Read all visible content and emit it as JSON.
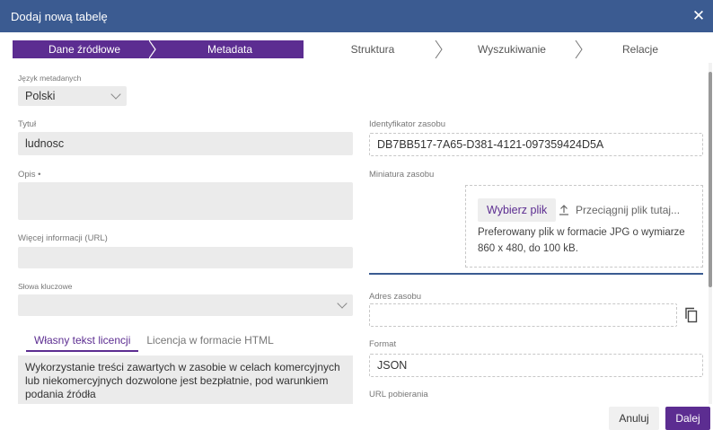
{
  "dialog": {
    "title": "Dodaj nową tabelę",
    "close_label": "✕"
  },
  "steps": [
    {
      "label": "Dane źródłowe",
      "active": true
    },
    {
      "label": "Metadata",
      "active": true
    },
    {
      "label": "Struktura",
      "active": false
    },
    {
      "label": "Wyszukiwanie",
      "active": false
    },
    {
      "label": "Relacje",
      "active": false
    }
  ],
  "form": {
    "lang_label": "Język metadanych",
    "lang_value": "Polski",
    "title_label": "Tytuł",
    "title_value": "ludnosc",
    "desc_label": "Opis •",
    "desc_value": "",
    "more_info_label": "Więcej informacji (URL)",
    "more_info_value": "",
    "keywords_label": "Słowa kluczowe",
    "keywords_value": "",
    "license_tabs": [
      "Własny tekst licencji",
      "Licencja w formacie HTML"
    ],
    "license_text": "Wykorzystanie treści zawartych w zasobie w celach komercyjnych lub niekomercyjnych dozwolone jest bezpłatnie, pod warunkiem podania źródła",
    "resource_id_label": "Identyfikator zasobu",
    "resource_id_value": "DB7BB517-7A65-D381-4121-097359424D5A",
    "thumb_label": "Miniatura zasobu",
    "choose_file": "Wybierz plik",
    "drag_text": "Przeciągnij plik tutaj...",
    "thumb_hint": "Preferowany plik w formacie JPG o wymiarze 860 x 480, do 100 kB.",
    "address_label": "Adres zasobu",
    "address_value": "",
    "format_label": "Format",
    "format_value": "JSON",
    "download_label": "URL pobierania"
  },
  "footer": {
    "cancel": "Anuluj",
    "next": "Dalej"
  },
  "colors": {
    "header": "#3b5b91",
    "accent": "#5c2d91",
    "field_bg": "#ebebeb"
  }
}
